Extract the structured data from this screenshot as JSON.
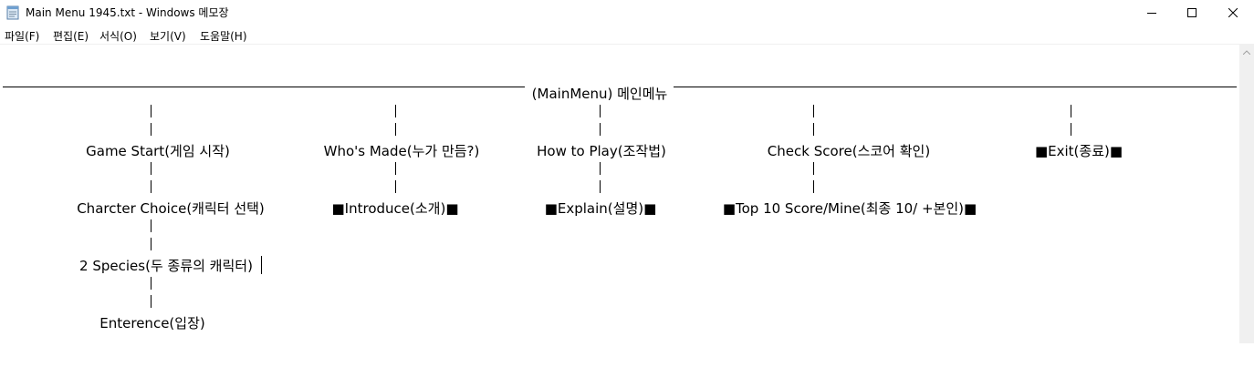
{
  "window": {
    "title": "Main Menu 1945.txt - Windows 메모장",
    "icon": "notepad-icon",
    "controls": [
      "minimize-icon",
      "maximize-icon",
      "close-icon"
    ]
  },
  "menubar": {
    "items": [
      {
        "label": "파일(F)"
      },
      {
        "label": "편집(E)"
      },
      {
        "label": "서식(O)"
      },
      {
        "label": "보기(V)"
      },
      {
        "label": "도움말(H)"
      }
    ]
  },
  "document": {
    "root": "(MainMenu) 메인메뉴",
    "game_start": "Game Start(게임 시작)",
    "charcter_choice": "Charcter Choice(캐릭터 선택)",
    "two_species": "2 Species(두 종류의 캐릭터)",
    "enterence": "Enterence(입장)",
    "whos_made": "Who's Made(누가 만듬?)",
    "introduce": "■Introduce(소개)■",
    "how_to_play": "How to Play(조작법)",
    "explain": "■Explain(설명)■",
    "check_score": "Check Score(스코어 확인)",
    "top_score": "■Top 10 Score/Mine(최종 10/ +본인)■",
    "exit": "■Exit(종료)■"
  }
}
